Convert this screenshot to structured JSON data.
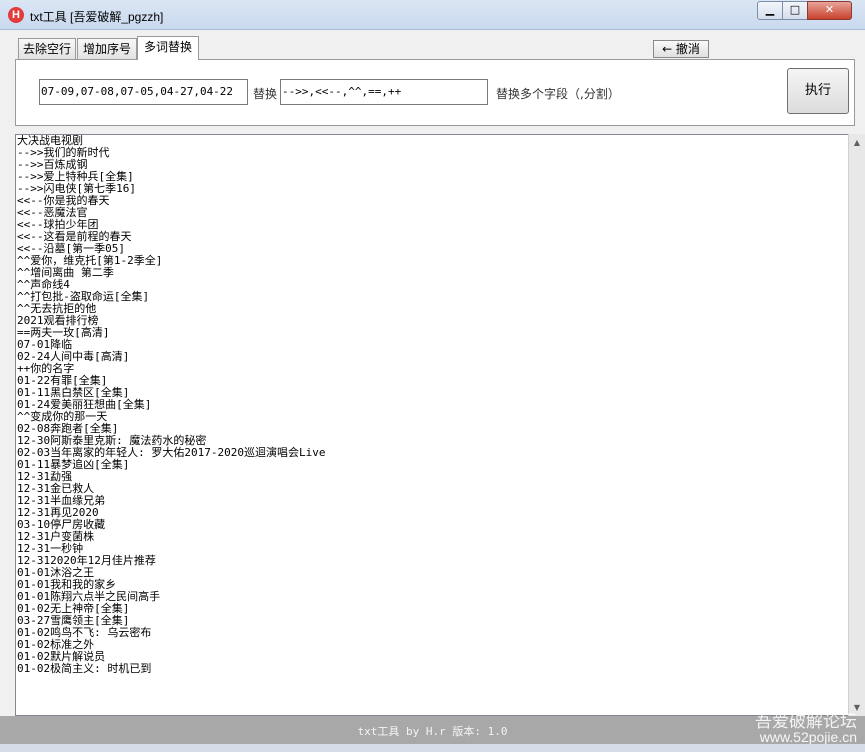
{
  "window": {
    "title": "txt工具 [吾爱破解_pgzzh]",
    "icon_letter": "H",
    "minimize": "▁",
    "maximize": "□",
    "close": "✕"
  },
  "tabs": [
    "去除空行",
    "增加序号",
    "多词替换"
  ],
  "active_tab": 2,
  "undo_label": "← 撤消",
  "panel": {
    "search_value": "07-09,07-08,07-05,04-27,04-22",
    "replace_label": "替换",
    "replace_value": "-->>,<<--,^^,==,++",
    "hint": "替换多个字段（,分割）",
    "execute_label": "执行"
  },
  "content_lines": [
    "大决战电视剧",
    "-->>我们的新时代",
    "-->>百炼成钢",
    "-->>爱上特种兵[全集]",
    "-->>闪电侠[第七季16]",
    "<<--你是我的春天",
    "<<--恶魔法官",
    "<<--球拍少年团",
    "<<--这看是前程的春天",
    "<<--沿墓[第一季05]",
    "^^爱你，维克托[第1-2季全]",
    "^^增间离曲 第二季",
    "^^声命线4",
    "^^打包批-盗取命运[全集]",
    "^^无去抗拒的他",
    "2021观看排行榜",
    "==两夫一玫[高清]",
    "07-01降临",
    "02-24人间中毒[高清]",
    "++你的名字",
    "01-22有罪[全集]",
    "01-11黑白禁区[全集]",
    "01-24爱美丽狂想曲[全集]",
    "^^变成你的那一天",
    "02-08奔跑者[全集]",
    "12-30阿斯泰里克斯: 魔法药水的秘密",
    "02-03当年离家的年轻人: 罗大佑2017-2020巡迴演唱会Live",
    "01-11暴梦追凶[全集]",
    "12-31勐强",
    "12-31金已救人",
    "12-31半血缘兄弟",
    "12-31再见2020",
    "03-10停尸房收藏",
    "12-31户变菌株",
    "12-31一秒钟",
    "12-312020年12月佳片推荐",
    "01-01沐浴之王",
    "01-01我和我的家乡",
    "01-01陈翔六点半之民间高手",
    "01-02无上神帝[全集]",
    "03-27雪鹰领主[全集]",
    "01-02鸣鸟不飞: 乌云密布",
    "01-02标准之外",
    "01-02默片解说员",
    "01-02极简主义: 时机已到"
  ],
  "status_bar": "txt工具 by H.r  版本: 1.0",
  "watermark": {
    "line1": "吾爱破解论坛",
    "line2": "www.52pojie.cn"
  }
}
